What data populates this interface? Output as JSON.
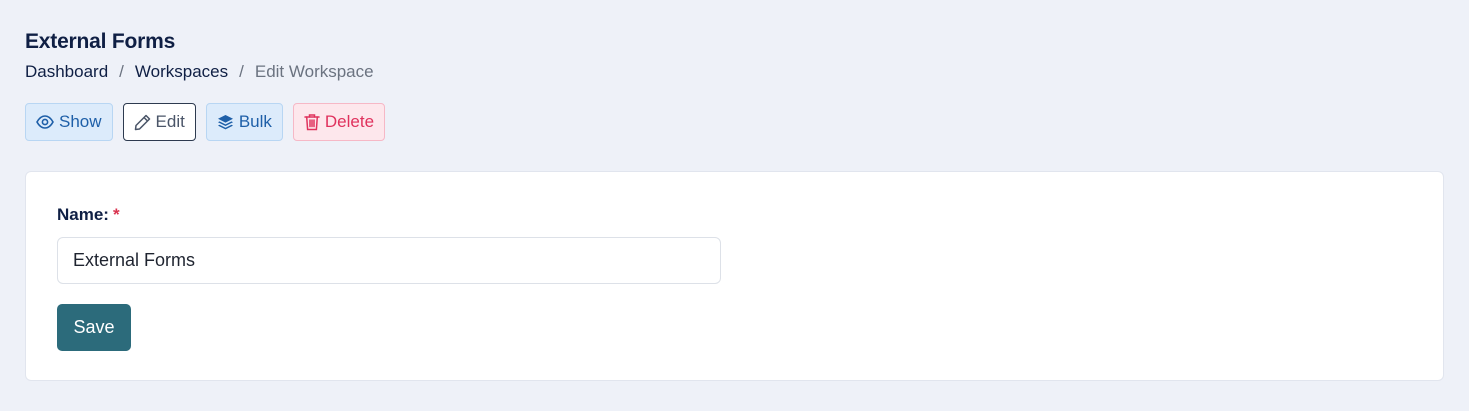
{
  "header": {
    "title": "External Forms"
  },
  "breadcrumb": {
    "items": [
      "Dashboard",
      "Workspaces"
    ],
    "separator": "/",
    "current": "Edit Workspace"
  },
  "actions": {
    "show_label": "Show",
    "edit_label": "Edit",
    "bulk_label": "Bulk",
    "delete_label": "Delete"
  },
  "form": {
    "name_label": "Name:",
    "required_marker": "*",
    "name_value": "External Forms",
    "save_label": "Save"
  },
  "icons": {
    "show": "eye-icon",
    "edit": "pencil-icon",
    "bulk": "layers-icon",
    "delete": "trash-icon"
  },
  "colors": {
    "background": "#eef1f8",
    "title": "#0f1f44",
    "show_bg": "#dcebfb",
    "show_text": "#1e5fa8",
    "delete_bg": "#fde7ec",
    "delete_text": "#e0325d",
    "save_bg": "#2c6b7b",
    "required": "#d9334f"
  }
}
